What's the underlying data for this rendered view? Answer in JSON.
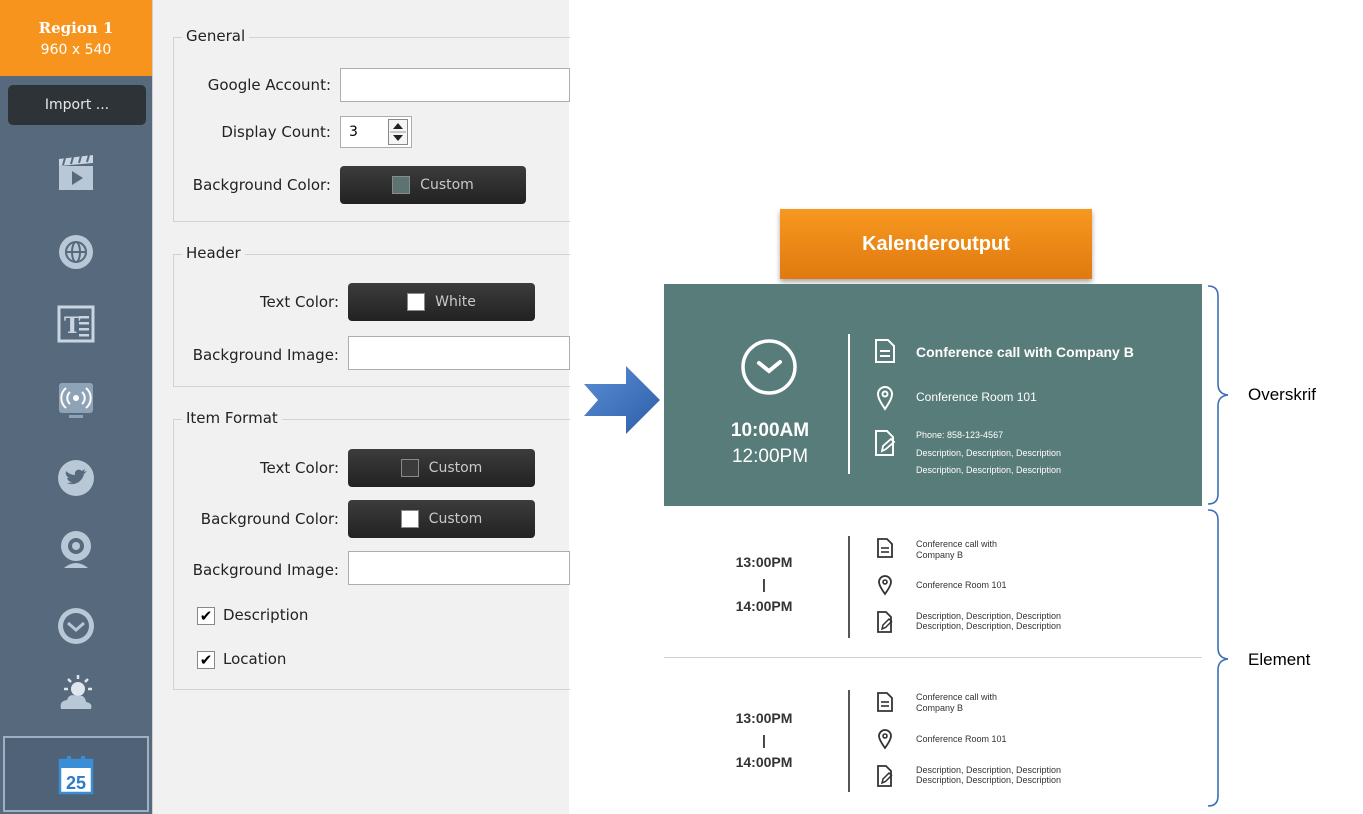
{
  "sidebar": {
    "region_title": "Region 1",
    "region_size": "960 x 540",
    "import_label": "Import ...",
    "icons": [
      "video-icon",
      "globe-icon",
      "text-icon",
      "broadcast-icon",
      "twitter-icon",
      "webcam-icon",
      "clock-icon",
      "weather-icon",
      "calendar-icon"
    ],
    "calendar_day": "25"
  },
  "panel": {
    "general": {
      "title": "General",
      "google_account_label": "Google Account:",
      "google_account_value": "",
      "display_count_label": "Display Count:",
      "display_count_value": "3",
      "background_color_label": "Background Color:",
      "background_color_button": "Custom"
    },
    "header": {
      "title": "Header",
      "text_color_label": "Text Color:",
      "text_color_button": "White",
      "background_image_label": "Background Image:",
      "background_image_value": ""
    },
    "item_format": {
      "title": "Item Format",
      "text_color_label": "Text Color:",
      "text_color_button": "Custom",
      "background_color_label": "Background Color:",
      "background_color_button": "Custom",
      "background_image_label": "Background Image:",
      "background_image_value": "",
      "description_label": "Description",
      "description_checked": true,
      "location_label": "Location",
      "location_checked": true
    }
  },
  "output": {
    "title": "Kalenderoutput",
    "header_event": {
      "start": "10:00AM",
      "end": "12:00PM",
      "title": "Conference call with Company B",
      "location": "Conference Room 101",
      "phone": "Phone: 858-123-4567",
      "desc1": "Description, Description, Description",
      "desc2": "Description, Description, Description"
    },
    "items": [
      {
        "start": "13:00PM",
        "sep": "|",
        "end": "14:00PM",
        "title1": "Conference call with",
        "title2": "Company B",
        "location": "Conference Room 101",
        "desc1": "Description, Description, Description",
        "desc2": "Description, Description, Description"
      },
      {
        "start": "13:00PM",
        "sep": "|",
        "end": "14:00PM",
        "title1": "Conference call with",
        "title2": "Company B",
        "location": "Conference Room 101",
        "desc1": "Description, Description, Description",
        "desc2": "Description, Description, Description"
      }
    ],
    "label_header": "Overskrif",
    "label_element": "Element"
  },
  "colors": {
    "accent_orange": "#f7941d",
    "sidebar_bg": "#56697d",
    "header_bg": "#587c79",
    "arrow_blue": "#3d72c4",
    "custom_swatch": "#5b7472"
  }
}
